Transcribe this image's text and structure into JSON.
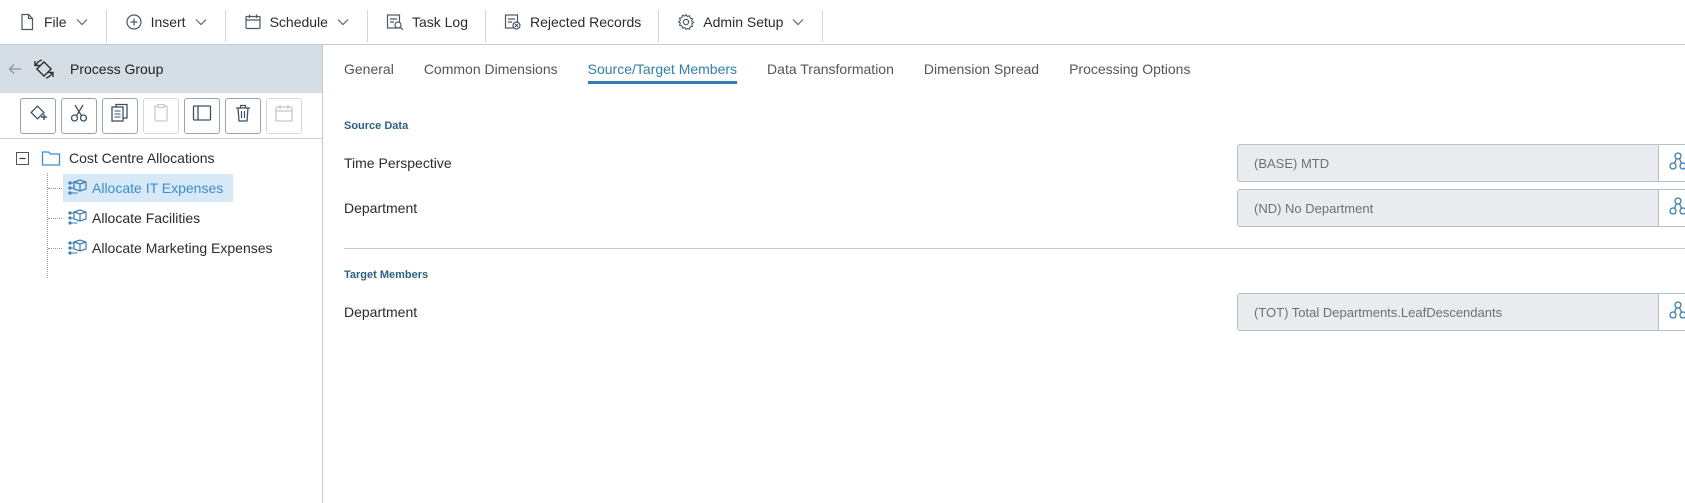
{
  "menubar": {
    "items": [
      {
        "label": "File",
        "icon": "file-icon",
        "has_caret": true
      },
      {
        "label": "Insert",
        "icon": "plus-circle-icon",
        "has_caret": true
      },
      {
        "label": "Schedule",
        "icon": "calendar-icon",
        "has_caret": true
      },
      {
        "label": "Task Log",
        "icon": "task-log-icon",
        "has_caret": false
      },
      {
        "label": "Rejected Records",
        "icon": "rejected-records-icon",
        "has_caret": false
      },
      {
        "label": "Admin Setup",
        "icon": "gear-icon",
        "has_caret": true
      }
    ]
  },
  "left_panel": {
    "title": "Process Group",
    "toolbar": [
      {
        "name": "add-process-button",
        "icon": "add-process-icon",
        "enabled": true
      },
      {
        "name": "cut-button",
        "icon": "scissors-icon",
        "enabled": true
      },
      {
        "name": "copy-button",
        "icon": "copy-icon",
        "enabled": true
      },
      {
        "name": "paste-button",
        "icon": "clipboard-icon",
        "enabled": false
      },
      {
        "name": "toggle-panel-button",
        "icon": "panel-icon",
        "enabled": true
      },
      {
        "name": "delete-button",
        "icon": "trash-icon",
        "enabled": true
      },
      {
        "name": "schedule-button",
        "icon": "calendar-icon",
        "enabled": false
      }
    ],
    "tree": {
      "root": {
        "label": "Cost Centre Allocations",
        "expanded": true
      },
      "children": [
        {
          "label": "Allocate IT Expenses",
          "selected": true
        },
        {
          "label": "Allocate Facilities",
          "selected": false
        },
        {
          "label": "Allocate Marketing Expenses",
          "selected": false
        }
      ]
    }
  },
  "tabs": [
    {
      "label": "General",
      "active": false
    },
    {
      "label": "Common Dimensions",
      "active": false
    },
    {
      "label": "Source/Target Members",
      "active": true
    },
    {
      "label": "Data Transformation",
      "active": false
    },
    {
      "label": "Dimension Spread",
      "active": false
    },
    {
      "label": "Processing Options",
      "active": false
    }
  ],
  "source_data": {
    "title": "Source Data",
    "rows": [
      {
        "label": "Time Perspective",
        "value": "(BASE) MTD"
      },
      {
        "label": "Department",
        "value": "(ND) No Department"
      }
    ]
  },
  "target_members": {
    "title": "Target Members",
    "rows": [
      {
        "label": "Department",
        "value": "(TOT) Total Departments.LeafDescendants"
      }
    ]
  },
  "colors": {
    "accent": "#2f7fb6",
    "header_bg": "#d5dde5",
    "selected_bg": "#d7e8f7",
    "selected_text": "#3a8fd0",
    "field_bg": "#e9ecef"
  }
}
